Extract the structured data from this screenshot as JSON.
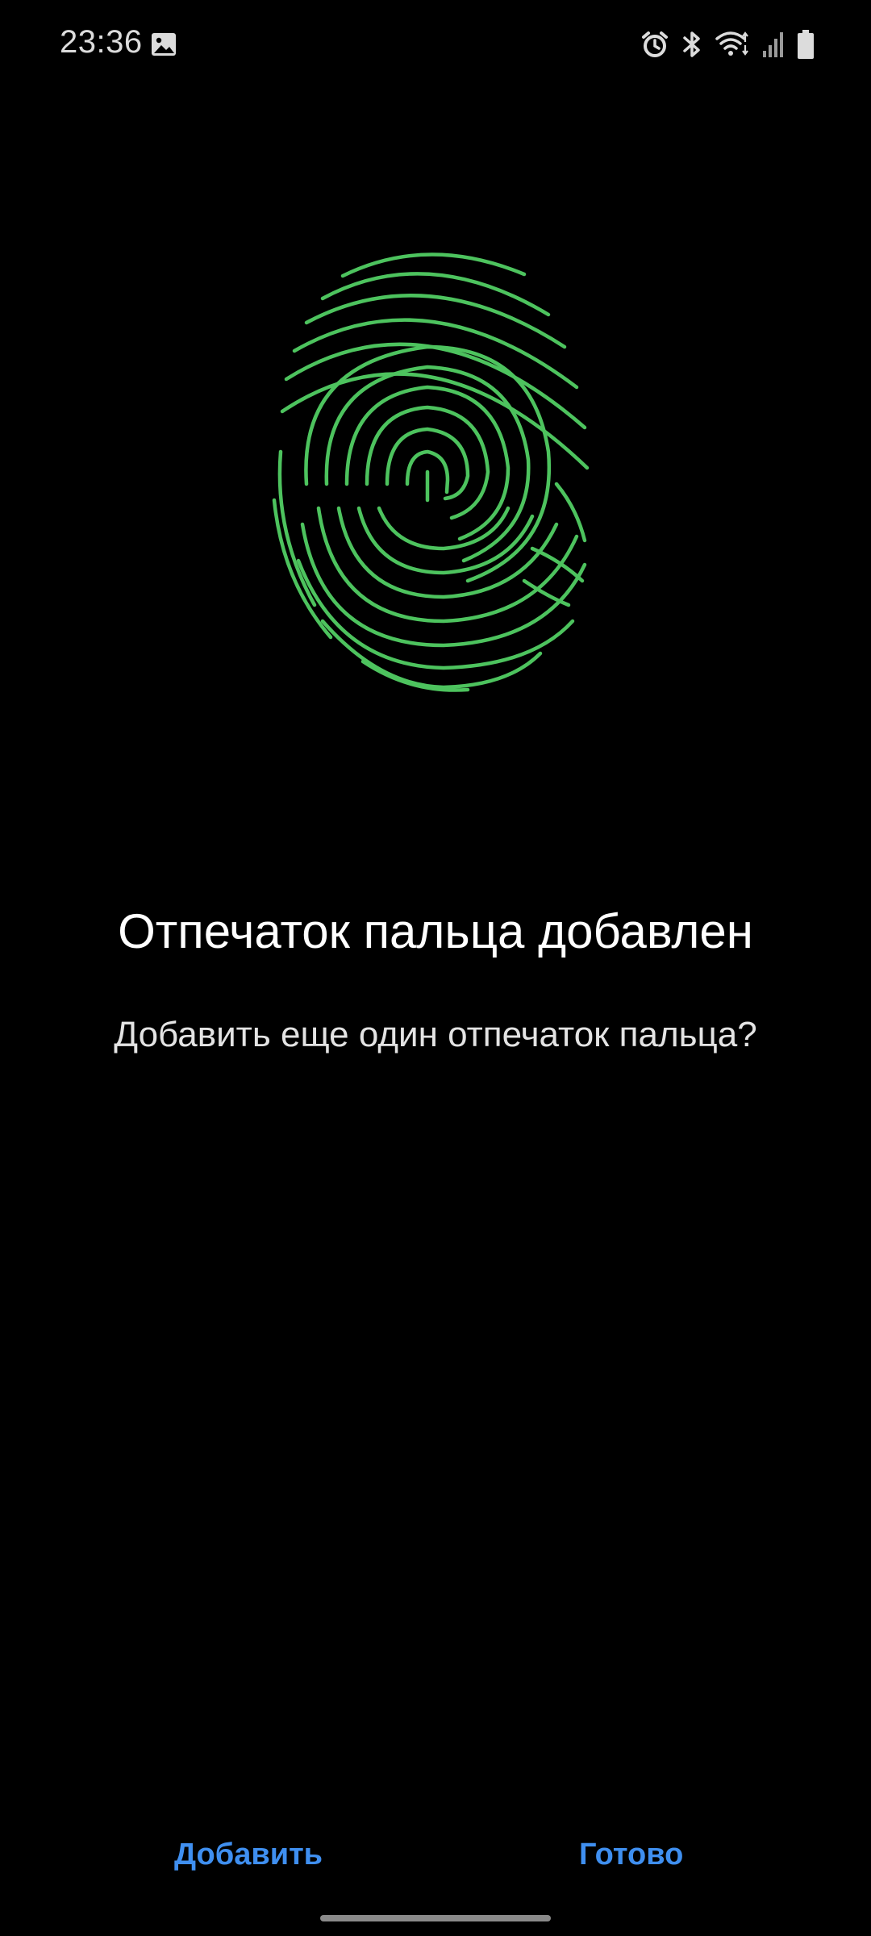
{
  "status_bar": {
    "time": "23:36",
    "left_icons": [
      "image-icon"
    ],
    "right_icons": [
      "alarm-icon",
      "bluetooth-icon",
      "wifi-icon",
      "signal-icon",
      "battery-icon"
    ]
  },
  "fingerprint": {
    "icon": "fingerprint-icon",
    "color": "#4dc35e"
  },
  "content": {
    "title": "Отпечаток пальца добавлен",
    "subtitle": "Добавить еще один отпечаток пальца?"
  },
  "buttons": {
    "add_label": "Добавить",
    "done_label": "Готово",
    "color": "#3f8ff0"
  }
}
